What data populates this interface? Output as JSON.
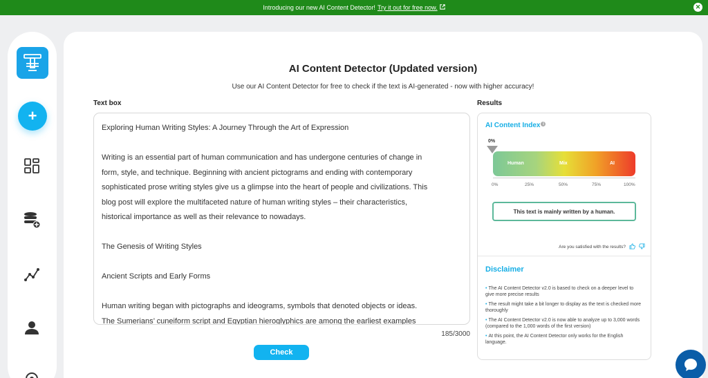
{
  "banner": {
    "text": "Introducing our new AI Content Detector!",
    "link": "Try it out for free now."
  },
  "sidebar": {
    "items": [
      "add",
      "dashboard",
      "database",
      "analytics",
      "profile"
    ]
  },
  "page": {
    "title": "AI Content Detector (Updated version)",
    "subtitle": "Use our AI Content Detector for free to check if the text is AI-generated - now with higher accuracy!",
    "textbox_label": "Text box",
    "results_label": "Results"
  },
  "textbox": {
    "lines": [
      "Exploring Human Writing Styles: A Journey Through the Art of Expression",
      "",
      "Writing is an essential part of human communication and has undergone centuries of change in",
      "form, style, and technique. Beginning with ancient pictograms and ending with contemporary",
      "sophisticated prose writing styles give us a glimpse into the heart of people and civilizations. This",
      "blog post will explore the multifaceted nature of human writing styles – their characteristics,",
      "historical importance as well as their relevance to nowadays.",
      "",
      "The Genesis of Writing Styles",
      "",
      "Ancient Scripts and Early Forms",
      "",
      "Human writing began with pictographs and ideograms, symbols that denoted objects or ideas.",
      "The Sumerians’ cuneiform script and Egyptian hieroglyphics are among the earliest examples"
    ],
    "counter": "185/3000",
    "check_label": "Check"
  },
  "results": {
    "index_title": "AI Content Index",
    "marker_value": "0%",
    "gradient_labels": {
      "human": "Human",
      "mix": "Mix",
      "ai": "AI"
    },
    "scale": [
      "0%",
      "25%",
      "50%",
      "75%",
      "100%"
    ],
    "ai_score": 0,
    "verdict": "This text is mainly written by a human.",
    "satisfied": "Are you satisfied with the results?",
    "disclaimer_title": "Disclaimer",
    "disclaimer_items": [
      "The AI Content Detector v2.0 is based to check on a deeper level to give more precise results",
      "The result might take a bit longer to display as the text is checked more thoroughly",
      "The AI Content Detector v2.0 is now able to analyze up to 3,000 words (compared to the 1,000 words of the first version)",
      "At this point, the AI Content Detector only works for the English language."
    ]
  },
  "colors": {
    "accent": "#12b3f0",
    "banner": "#1f8a1a",
    "verdict_border": "#5cb89a"
  }
}
